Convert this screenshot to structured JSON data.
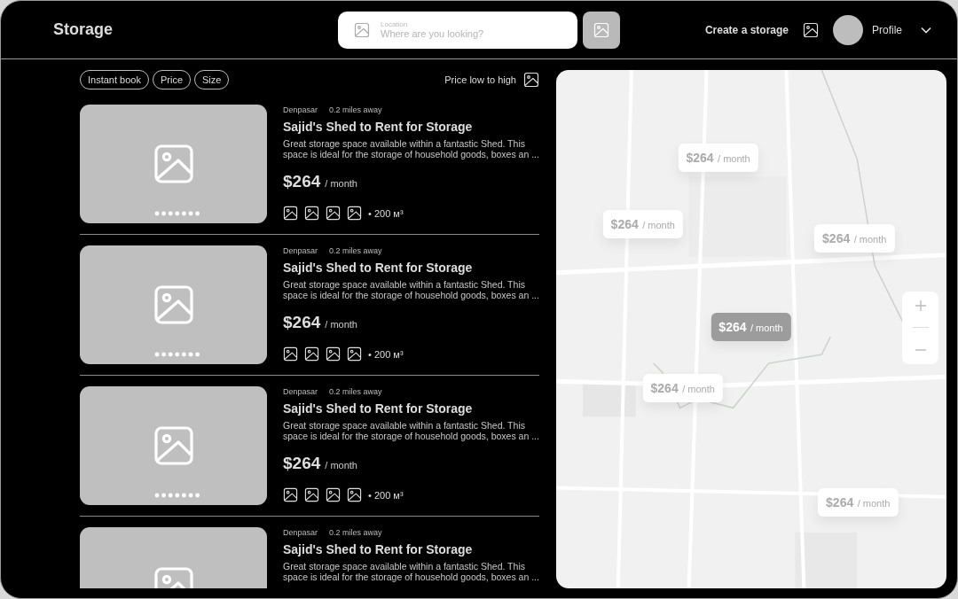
{
  "header": {
    "brand": "Storage",
    "search": {
      "label": "Location",
      "placeholder": "Where are you looking?"
    },
    "create_link": "Create a storage",
    "profile": {
      "name": "Profile"
    }
  },
  "filters": [
    {
      "label": "Instant book"
    },
    {
      "label": "Price"
    },
    {
      "label": "Size"
    }
  ],
  "sort": {
    "label": "Price low to high"
  },
  "listings": [
    {
      "city": "Denpasar",
      "distance": "0.2 miles away",
      "title": "Sajid's Shed to Rent for Storage",
      "description": "Great storage space available within a fantastic Shed. This space is ideal for the storage of household goods, boxes an ...",
      "price": "$264",
      "period": "/ month",
      "size": "• 200 м³"
    },
    {
      "city": "Denpasar",
      "distance": "0.2 miles away",
      "title": "Sajid's Shed to Rent for Storage",
      "description": "Great storage space available within a fantastic Shed. This space is ideal for the storage of household goods, boxes an ...",
      "price": "$264",
      "period": "/ month",
      "size": "• 200 м³"
    },
    {
      "city": "Denpasar",
      "distance": "0.2 miles away",
      "title": "Sajid's Shed to Rent for Storage",
      "description": "Great storage space available within a fantastic Shed. This space is ideal for the storage of household goods, boxes an ...",
      "price": "$264",
      "period": "/ month",
      "size": "• 200 м³"
    },
    {
      "city": "Denpasar",
      "distance": "0.2 miles away",
      "title": "Sajid's Shed to Rent for Storage",
      "description": "Great storage space available within a fantastic Shed. This space is ideal for the storage of household goods, boxes an ..."
    }
  ],
  "map": {
    "kind": "picture",
    "pins": [
      {
        "price": "$264",
        "period": "/ month",
        "selected": false
      },
      {
        "price": "$264",
        "period": "/ month",
        "selected": false
      },
      {
        "price": "$264",
        "period": "/ month",
        "selected": false
      },
      {
        "price": "$264",
        "period": "/ month",
        "selected": true
      },
      {
        "price": "$264",
        "period": "/ month",
        "selected": false
      },
      {
        "price": "$264",
        "period": "/ month",
        "selected": false
      }
    ]
  }
}
